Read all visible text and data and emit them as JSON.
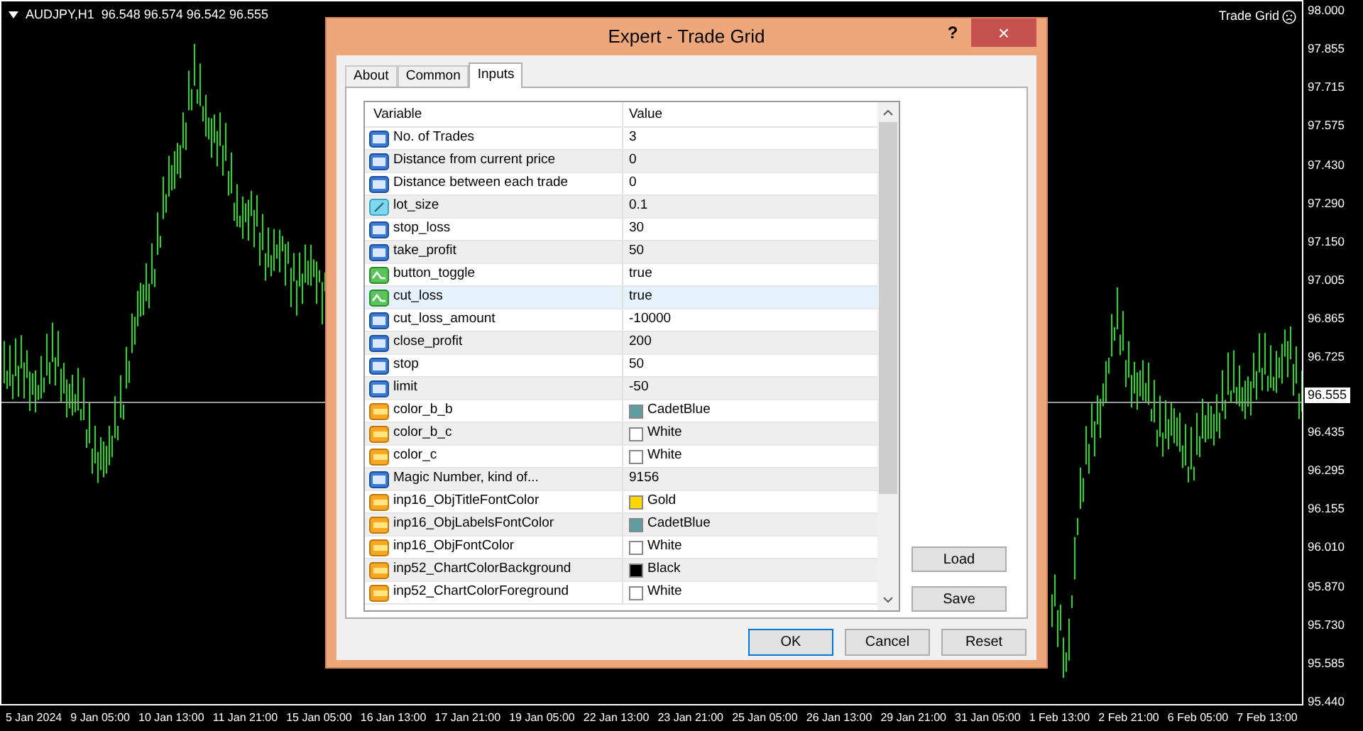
{
  "chart": {
    "symbol": "AUDJPY,H1",
    "ohlc": "96.548 96.574 96.542 96.555",
    "expert_label": "Trade Grid",
    "current_price": "96.555",
    "price_axis": [
      "98.000",
      "97.855",
      "97.715",
      "97.575",
      "97.430",
      "97.290",
      "97.150",
      "97.005",
      "96.865",
      "96.725",
      "96.435",
      "96.295",
      "96.155",
      "96.010",
      "95.870",
      "95.730",
      "95.585",
      "95.440"
    ],
    "time_axis": [
      "5 Jan 2024",
      "9 Jan 05:00",
      "10 Jan 13:00",
      "11 Jan 21:00",
      "15 Jan 05:00",
      "16 Jan 13:00",
      "17 Jan 21:00",
      "19 Jan 05:00",
      "22 Jan 13:00",
      "23 Jan 21:00",
      "25 Jan 05:00",
      "26 Jan 13:00",
      "29 Jan 21:00",
      "31 Jan 05:00",
      "1 Feb 13:00",
      "2 Feb 21:00",
      "6 Feb 05:00",
      "7 Feb 13:00"
    ]
  },
  "dialog": {
    "title": "Expert - Trade Grid",
    "help": "?",
    "close": "×",
    "tabs": [
      {
        "label": "About",
        "selected": false
      },
      {
        "label": "Common",
        "selected": false
      },
      {
        "label": "Inputs",
        "selected": true
      }
    ],
    "table": {
      "columns": [
        "Variable",
        "Value"
      ],
      "rows": [
        {
          "kind": "int",
          "variable": "No. of Trades",
          "value": "3",
          "selected": false
        },
        {
          "kind": "int",
          "variable": "Distance from current price",
          "value": "0",
          "selected": false
        },
        {
          "kind": "int",
          "variable": "Distance between each trade",
          "value": "0",
          "selected": false
        },
        {
          "kind": "double",
          "variable": "lot_size",
          "value": "0.1",
          "selected": false
        },
        {
          "kind": "int",
          "variable": "stop_loss",
          "value": "30",
          "selected": false
        },
        {
          "kind": "int",
          "variable": "take_profit",
          "value": "50",
          "selected": false
        },
        {
          "kind": "bool",
          "variable": "button_toggle",
          "value": "true",
          "selected": false
        },
        {
          "kind": "bool",
          "variable": "cut_loss",
          "value": "true",
          "selected": true
        },
        {
          "kind": "int",
          "variable": "cut_loss_amount",
          "value": "-10000",
          "selected": false
        },
        {
          "kind": "int",
          "variable": "close_profit",
          "value": "200",
          "selected": false
        },
        {
          "kind": "int",
          "variable": "stop",
          "value": "50",
          "selected": false
        },
        {
          "kind": "int",
          "variable": "limit",
          "value": "-50",
          "selected": false
        },
        {
          "kind": "color",
          "variable": "color_b_b",
          "value": "CadetBlue",
          "color": "#5f9ea0",
          "selected": false
        },
        {
          "kind": "color",
          "variable": "color_b_c",
          "value": "White",
          "color": "#ffffff",
          "selected": false
        },
        {
          "kind": "color",
          "variable": "color_c",
          "value": "White",
          "color": "#ffffff",
          "selected": false
        },
        {
          "kind": "int",
          "variable": "Magic Number, kind of...",
          "value": "9156",
          "selected": false
        },
        {
          "kind": "color",
          "variable": "inp16_ObjTitleFontColor",
          "value": "Gold",
          "color": "#ffd700",
          "selected": false
        },
        {
          "kind": "color",
          "variable": "inp16_ObjLabelsFontColor",
          "value": "CadetBlue",
          "color": "#5f9ea0",
          "selected": false
        },
        {
          "kind": "color",
          "variable": "inp16_ObjFontColor",
          "value": "White",
          "color": "#ffffff",
          "selected": false
        },
        {
          "kind": "color",
          "variable": "inp52_ChartColorBackground",
          "value": "Black",
          "color": "#000000",
          "selected": false
        },
        {
          "kind": "color",
          "variable": "inp52_ChartColorForeground",
          "value": "White",
          "color": "#ffffff",
          "selected": false
        }
      ]
    },
    "side_buttons": [
      "Load",
      "Save"
    ],
    "buttons": [
      {
        "label": "OK",
        "default": true
      },
      {
        "label": "Cancel",
        "default": false
      },
      {
        "label": "Reset",
        "default": false
      }
    ]
  }
}
